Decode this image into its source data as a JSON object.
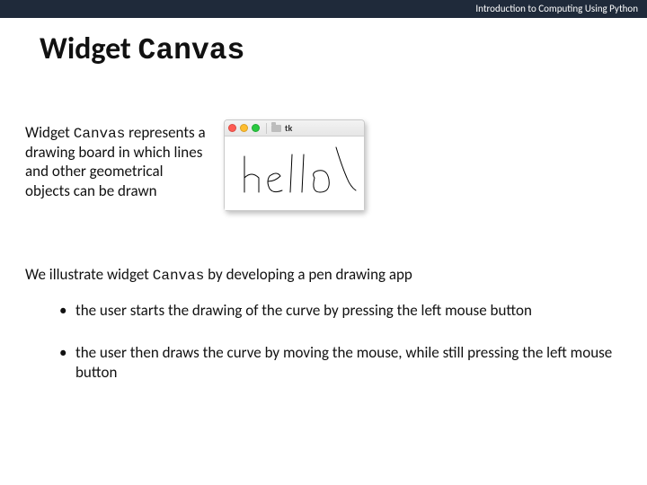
{
  "header": {
    "breadcrumb": "Introduction to Computing Using Python"
  },
  "title": {
    "prefix": "Widget ",
    "mono": "Canvas"
  },
  "desc": {
    "prefix": "Widget ",
    "mono": "Canvas",
    "rest": " represents a drawing board in which lines and other geometrical objects can be drawn"
  },
  "window": {
    "title": "tk"
  },
  "after": {
    "pre": "We illustrate widget ",
    "mono": "Canvas",
    "post": " by developing a pen drawing app"
  },
  "bullets": [
    "the user starts the drawing of the curve by pressing the left mouse button",
    "the user then draws the curve by moving the mouse, while still pressing the left mouse button"
  ]
}
